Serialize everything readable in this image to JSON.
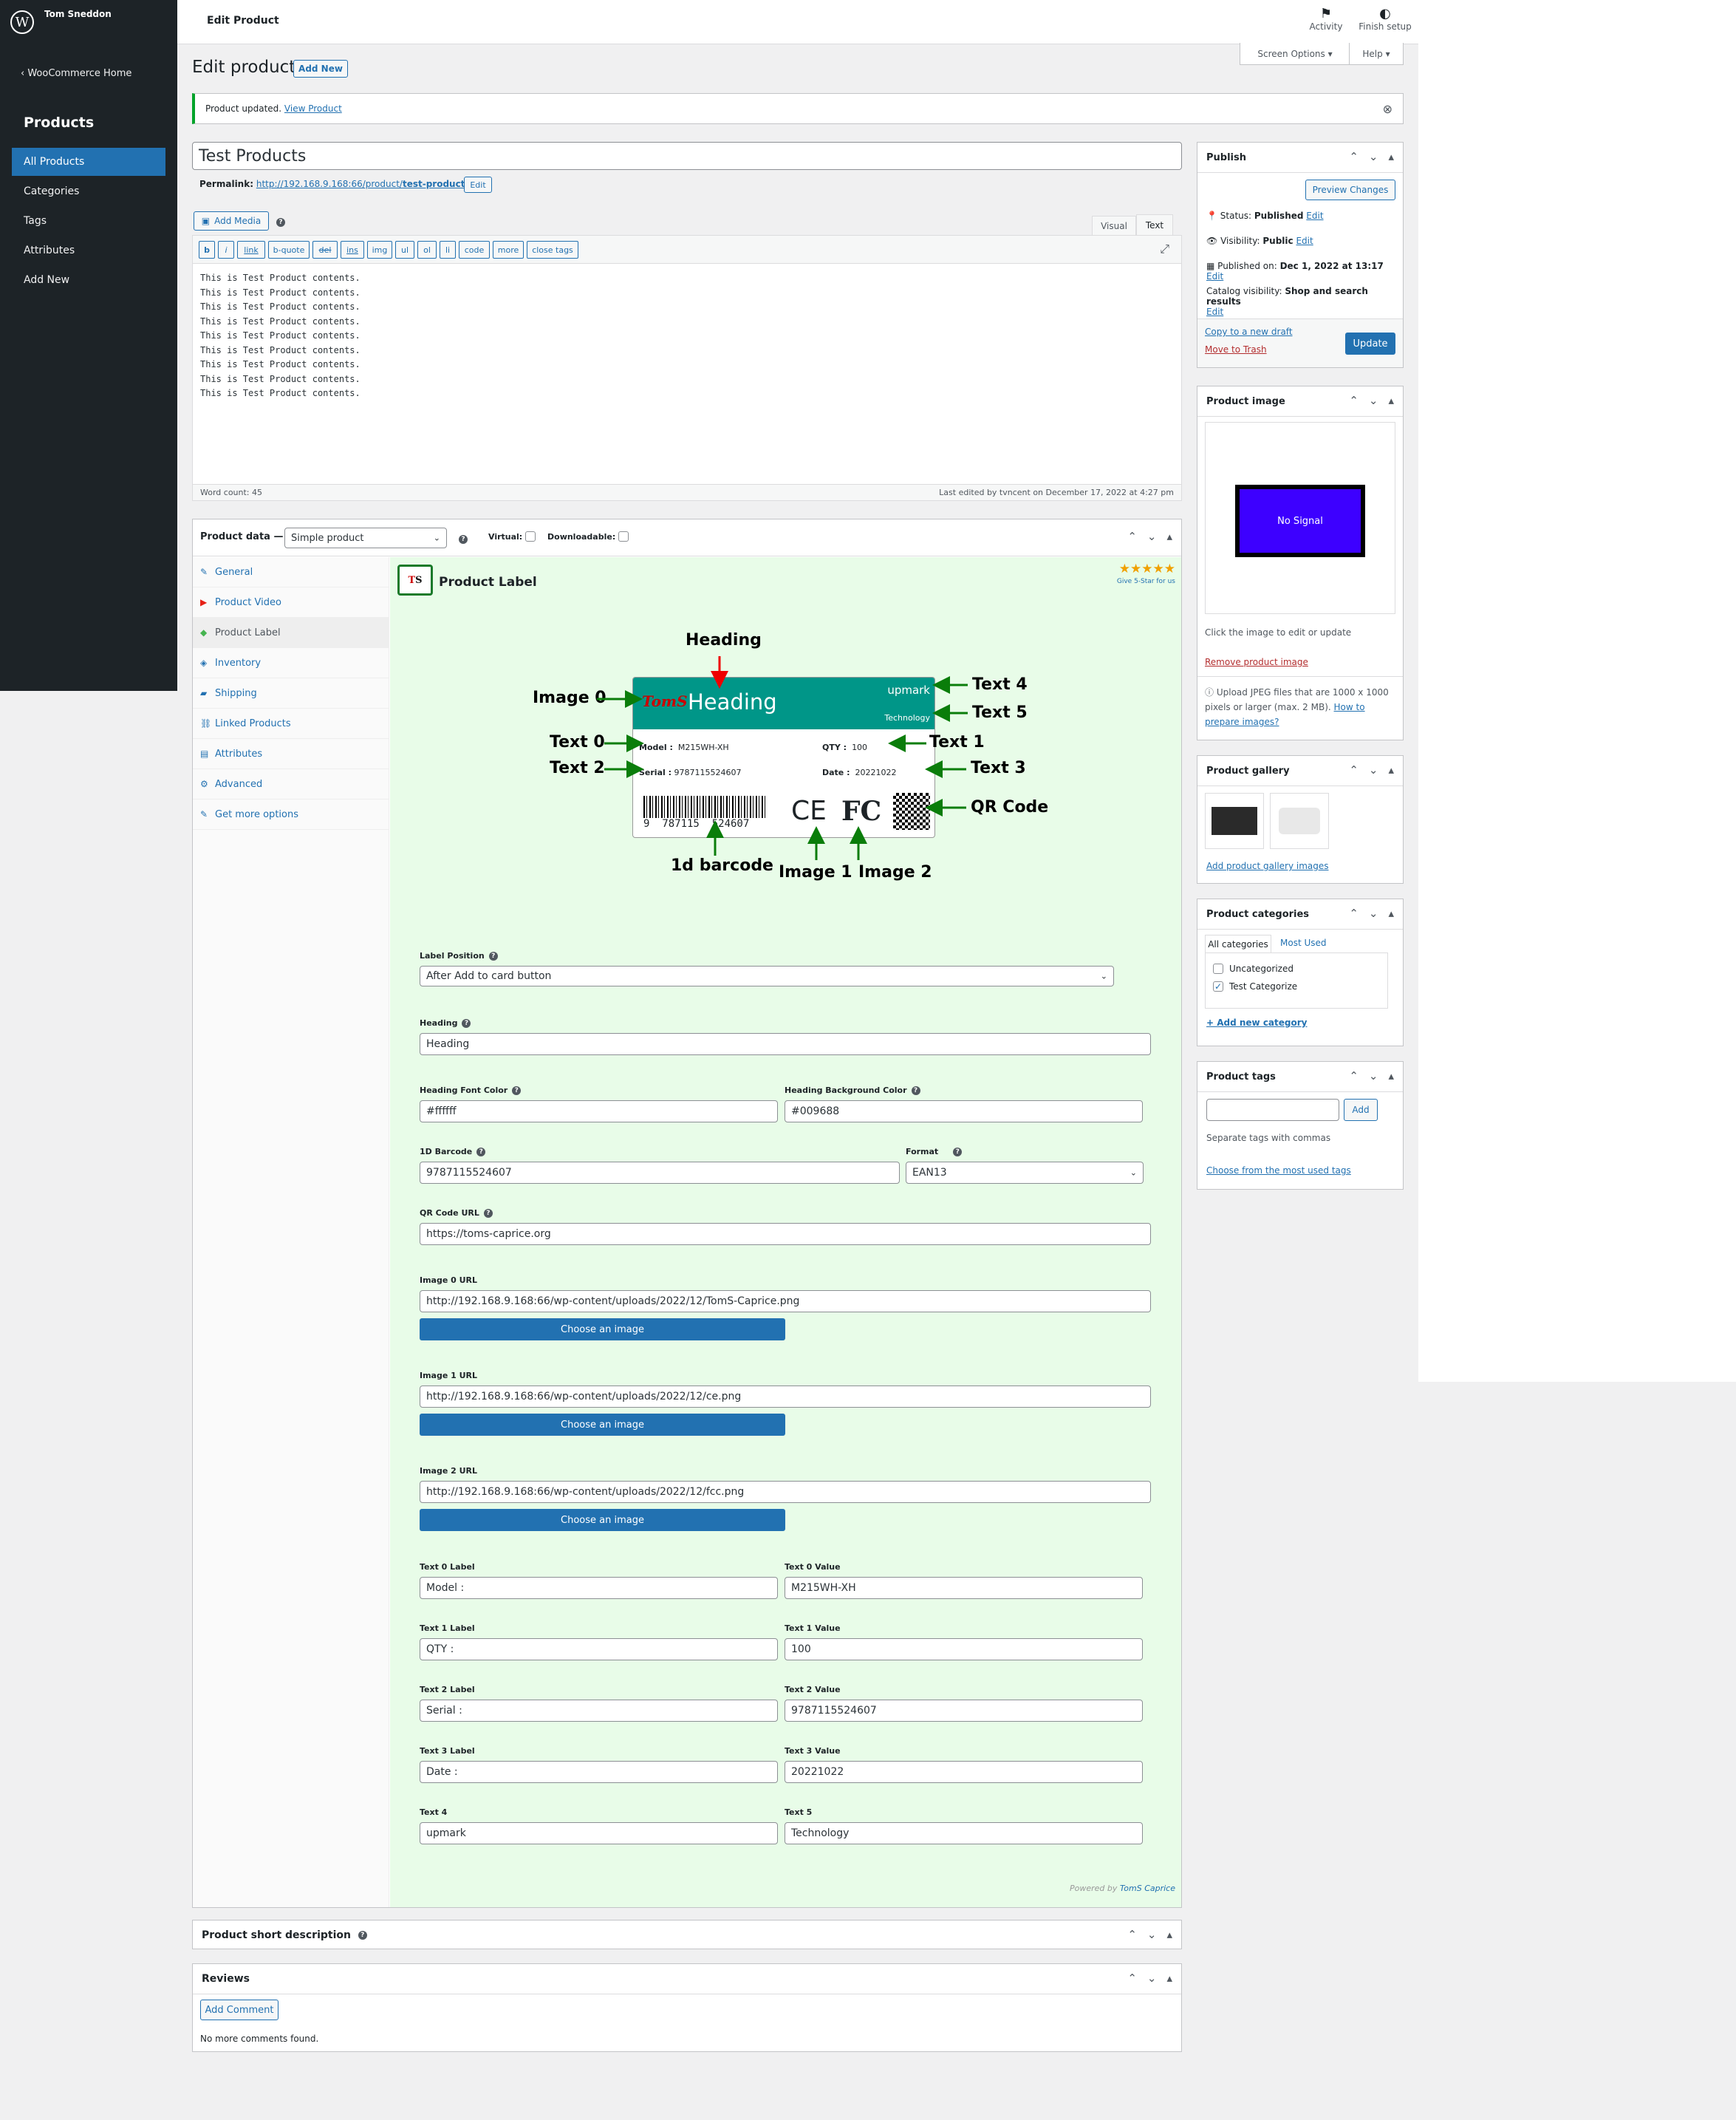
{
  "topbar": {
    "user": "Tom Sneddon",
    "page": "Edit Product",
    "activity": "Activity",
    "finish_setup": "Finish setup"
  },
  "sidebar": {
    "woo_home": "WooCommerce Home",
    "section": "Products",
    "items": [
      "All Products",
      "Categories",
      "Tags",
      "Attributes",
      "Add New"
    ]
  },
  "screen_options": "Screen Options ▾",
  "help": "Help ▾",
  "heading": {
    "title": "Edit product",
    "add_new": "Add New"
  },
  "notice": {
    "text": "Product updated.",
    "link": "View Product"
  },
  "product": {
    "title": "Test Products",
    "permalink_label": "Permalink:",
    "permalink_base": "http://192.168.9.168:66/product/",
    "permalink_slug": "test-products",
    "permalink_tail": "/",
    "edit": "Edit"
  },
  "editor": {
    "add_media": "Add Media",
    "visual": "Visual",
    "text": "Text",
    "quicktags": [
      "b",
      "i",
      "link",
      "b-quote",
      "del",
      "ins",
      "img",
      "ul",
      "ol",
      "li",
      "code",
      "more",
      "close tags"
    ],
    "lines": [
      "This is Test Product contents.",
      "This is Test Product contents.",
      "This is Test Product contents.",
      "This is Test Product contents.",
      "This is Test Product contents.",
      "This is Test Product contents.",
      "This is Test Product contents.",
      "This is Test Product contents.",
      "This is Test Product contents."
    ],
    "word_count": "Word count: 45",
    "last_edited": "Last edited by tvncent on December 17, 2022 at 4:27 pm"
  },
  "product_data": {
    "label": "Product data —",
    "type": "Simple product",
    "virtual": "Virtual:",
    "downloadable": "Downloadable:",
    "tabs": [
      "General",
      "Product Video",
      "Product Label",
      "Inventory",
      "Shipping",
      "Linked Products",
      "Attributes",
      "Advanced",
      "Get more options"
    ]
  },
  "label_plugin": {
    "title": "Product Label",
    "stars": "★★★★★",
    "give": "Give 5-Star for us",
    "powered_by": "Powered by",
    "brand": "TomS Caprice"
  },
  "preview": {
    "heading": "Heading",
    "text4": "upmark",
    "text5": "Technology",
    "model_label": "Model :",
    "model_value": "M215WH-XH",
    "qty_label": "QTY :",
    "qty_value": "100",
    "serial_label": "Serial :",
    "serial_value": "9787115524607",
    "date_label": "Date :",
    "date_value": "20221022",
    "barcode_digits": "9  787115  524607",
    "logo_text": "TomS",
    "ce": "CE",
    "fc": "FC"
  },
  "annotations": {
    "heading": "Heading",
    "image0": "Image 0",
    "text0": "Text 0",
    "text2": "Text 2",
    "text4": "Text 4",
    "text5": "Text 5",
    "text1": "Text 1",
    "text3": "Text 3",
    "qr": "QR Code",
    "barcode": "1d barcode",
    "image1": "Image 1",
    "image2": "Image 2"
  },
  "form": {
    "label_position": {
      "label": "Label Position",
      "value": "After Add to card button"
    },
    "heading": {
      "label": "Heading",
      "value": "Heading"
    },
    "heading_font_color": {
      "label": "Heading Font Color",
      "value": "#ffffff"
    },
    "heading_bg_color": {
      "label": "Heading Background Color",
      "value": "#009688"
    },
    "barcode": {
      "label": "1D Barcode",
      "value": "9787115524607"
    },
    "format": {
      "label": "Format",
      "value": "EAN13"
    },
    "qr_url": {
      "label": "QR Code URL",
      "value": "https://toms-caprice.org"
    },
    "image0": {
      "label": "Image 0 URL",
      "value": "http://192.168.9.168:66/wp-content/uploads/2022/12/TomS-Caprice.png"
    },
    "image1": {
      "label": "Image 1 URL",
      "value": "http://192.168.9.168:66/wp-content/uploads/2022/12/ce.png"
    },
    "image2": {
      "label": "Image 2 URL",
      "value": "http://192.168.9.168:66/wp-content/uploads/2022/12/fcc.png"
    },
    "choose": "Choose an image",
    "t0l": {
      "label": "Text 0 Label",
      "value": "Model :"
    },
    "t0v": {
      "label": "Text 0 Value",
      "value": "M215WH-XH"
    },
    "t1l": {
      "label": "Text 1 Label",
      "value": "QTY :"
    },
    "t1v": {
      "label": "Text 1 Value",
      "value": "100"
    },
    "t2l": {
      "label": "Text 2 Label",
      "value": "Serial :"
    },
    "t2v": {
      "label": "Text 2 Value",
      "value": "9787115524607"
    },
    "t3l": {
      "label": "Text 3 Label",
      "value": "Date :"
    },
    "t3v": {
      "label": "Text 3 Value",
      "value": "20221022"
    },
    "t4": {
      "label": "Text 4",
      "value": "upmark"
    },
    "t5": {
      "label": "Text 5",
      "value": "Technology"
    }
  },
  "short_desc": "Product short description",
  "reviews": {
    "title": "Reviews",
    "add_comment": "Add Comment",
    "none": "No more comments found."
  },
  "publish": {
    "title": "Publish",
    "preview": "Preview Changes",
    "status_label": "Status:",
    "status": "Published",
    "visibility_label": "Visibility:",
    "visibility": "Public",
    "published_label": "Published on:",
    "published": "Dec 1, 2022 at 13:17",
    "catalog_label": "Catalog visibility:",
    "catalog": "Shop and search results",
    "edit": "Edit",
    "copy": "Copy to a new draft",
    "trash": "Move to Trash",
    "update": "Update"
  },
  "product_image": {
    "title": "Product image",
    "no_signal": "No Signal",
    "hint": "Click the image to edit or update",
    "remove": "Remove product image",
    "upload_note": "Upload JPEG files that are 1000 x 1000 pixels or larger (max. 2 MB).",
    "how": "How to prepare images?"
  },
  "gallery": {
    "title": "Product gallery",
    "add": "Add product gallery images"
  },
  "categories": {
    "title": "Product categories",
    "tab_all": "All categories",
    "tab_most": "Most Used",
    "items": [
      "Uncategorized",
      "Test Categorize"
    ],
    "add": "+ Add new category"
  },
  "tags": {
    "title": "Product tags",
    "add": "Add",
    "hint": "Separate tags with commas",
    "choose": "Choose from the most used tags"
  },
  "colors": {
    "accent": "#2271b1",
    "teal": "#009688",
    "sidebar": "#1d2327",
    "panel": "#e8fce8"
  }
}
